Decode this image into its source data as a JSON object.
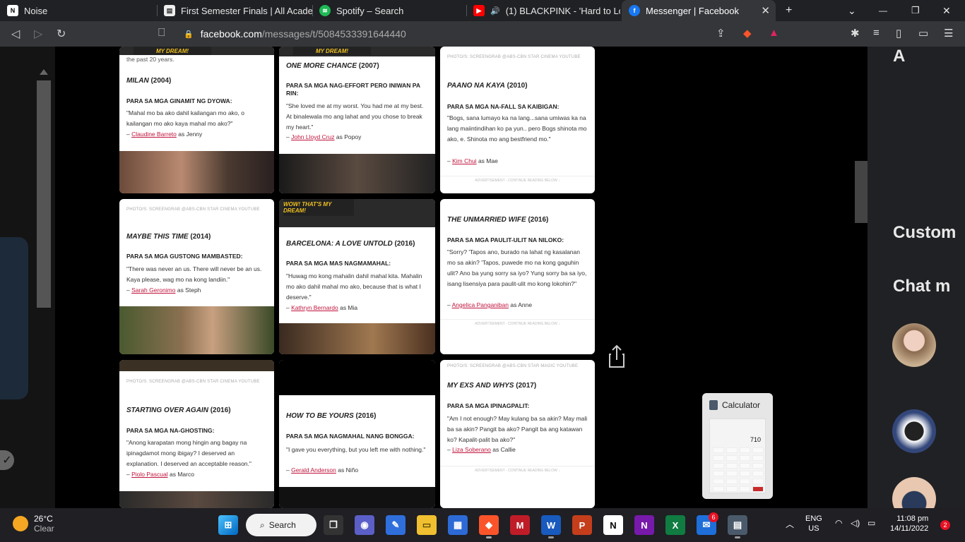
{
  "tabs": [
    {
      "title": "Noise",
      "icon": "notion-icon"
    },
    {
      "title": "First Semester Finals | All Academi",
      "icon": "document-icon"
    },
    {
      "title": "Spotify – Search",
      "icon": "spotify-icon"
    },
    {
      "title": "(1) BLACKPINK - 'Hard to Love",
      "icon": "youtube-icon"
    },
    {
      "title": "Messenger | Facebook",
      "icon": "facebook-icon"
    }
  ],
  "tab_controls": {
    "new_tab": "+",
    "minimize": "—",
    "restore": "❐",
    "close": "✕",
    "dropdown": "⌄"
  },
  "address": {
    "host": "facebook.com",
    "path": "/messages/t/5084533391644440"
  },
  "cards": [
    {
      "banner": "MY DREAM!",
      "lead": "the past 20 years.",
      "title": "MILAN",
      "year": "(2004)",
      "para": "PARA SA MGA GINAMIT NG DYOWA:",
      "quote": "\"Mahal mo ba ako dahil kailangan mo ako, o kailangan mo ako kaya mahal mo ako?\"",
      "actor": "Claudine Barreto",
      "role": "as Jenny"
    },
    {
      "banner": "MY DREAM!",
      "title": "ONE MORE CHANCE",
      "year": "(2007)",
      "para": "PARA SA MGA NAG-EFFORT PERO INIWAN PA RIN:",
      "quote": "\"She loved me at my worst. You had me at my best. At binalewala mo ang lahat and you chose to break my heart.\"",
      "actor": "John Lloyd Cruz",
      "role": "as Popoy"
    },
    {
      "credit": "PHOTO/S: SCREENGRAB @ABS-CBN STAR CINEMA YOUTUBE",
      "title": "PAANO NA KAYA",
      "year": "(2010)",
      "para": "PARA SA MGA NA-FALL SA KAIBIGAN:",
      "quote": "\"Bogs, sana lumayo ka na lang...sana umiwas ka na lang maiintindihan ko pa yun.. pero Bogs shinota mo ako, e. Shinota mo ang bestfriend mo.\"",
      "actor": "Kim Chui",
      "role": "as Mae",
      "ad": "ADVERTISEMENT - CONTINUE READING BELOW ↓"
    },
    {
      "credit": "PHOTO/S: SCREENGRAB @ABS-CBN STAR CINEMA YOUTUBE",
      "title": "MAYBE THIS TIME",
      "year": "(2014)",
      "para": "PARA SA MGA GUSTONG MAMBASTED:",
      "quote": "\"There was never an us. There will never be an us. Kaya please, wag mo na kong landiin.\"",
      "actor": "Sarah Geronimo",
      "role": "as Steph"
    },
    {
      "banner": "WOW! THAT'S MY DREAM!",
      "title": "BARCELONA: A LOVE UNTOLD",
      "year": "(2016)",
      "para": "PARA SA MGA MAS NAGMAMAHAL:",
      "quote": "\"Huwag mo kong mahalin dahil mahal kita. Mahalin mo ako dahil mahal mo ako, because that is what I deserve.\"",
      "actor": "Kathryn Bernardo",
      "role": "as Mia"
    },
    {
      "title": "THE UNMARRIED WIFE",
      "year": "(2016)",
      "para": "PARA SA MGA PAULIT-ULIT NA NILOKO:",
      "quote": "\"Sorry? 'Tapos ano, burado na lahat ng kasalanan mo sa akin? 'Tapos, puwede mo na kong gaguhin ulit? Ano ba yung sorry sa iyo? Yung sorry ba sa iyo, isang lisensiya para paulit-ulit mo kong lokohin?\"",
      "actor": "Angelica Panganiban",
      "role": "as Anne",
      "ad": "ADVERTISEMENT - CONTINUE READING BELOW ↓"
    },
    {
      "credit": "PHOTO/S: SCREENGRAB @ABS-CBN STAR CINEMA YOUTUBE",
      "title": "STARTING OVER AGAIN",
      "year": "(2016)",
      "para": "PARA SA MGA NA-GHOSTING:",
      "quote": "\"Anong karapatan mong hingin ang bagay na ipinagdamot mong ibigay? I deserved an explanation. I deserved an acceptable reason.\"",
      "actor": "Piolo Pascual",
      "role": "as Marco"
    },
    {
      "title": "HOW TO BE YOURS",
      "year": "(2016)",
      "para": "PARA SA MGA NAGMAHAL NANG BONGGA:",
      "quote": "\"I gave you everything, but you left me with nothing.\"",
      "actor": "Gerald Anderson",
      "role": "as Niño"
    },
    {
      "credit": "PHOTO/S: SCREENGRAB @ABS-CBN STAR MAGIC YOUTUBE",
      "title": "MY EXS AND WHYS",
      "year": "(2017)",
      "para": "PARA SA MGA IPINAGPALIT:",
      "quote": "\"Am I not enough? May kulang ba sa akin? May mali ba sa akin? Pangit ba ako? Pangit ba ang katawan ko? Kapalit-palit ba ako?\"",
      "actor": "Liza Soberano",
      "role": "as Callie",
      "ad": "ADVERTISEMENT - CONTINUE READING BELOW ↓"
    }
  ],
  "right_panel": {
    "heading_top": "A",
    "heading_1": "Custom",
    "heading_2": "Chat m"
  },
  "calculator_popup": {
    "title": "Calculator",
    "display": "710"
  },
  "taskbar": {
    "weather_temp": "26°C",
    "weather_desc": "Clear",
    "search_label": "Search",
    "store_badge": "6",
    "lang_1": "ENG",
    "lang_2": "US",
    "time": "11:08 pm",
    "date": "14/11/2022",
    "notif_count": "2"
  },
  "colors": {
    "link": "#c0143c",
    "facebook": "#1877f2",
    "brave": "#fb542b"
  }
}
